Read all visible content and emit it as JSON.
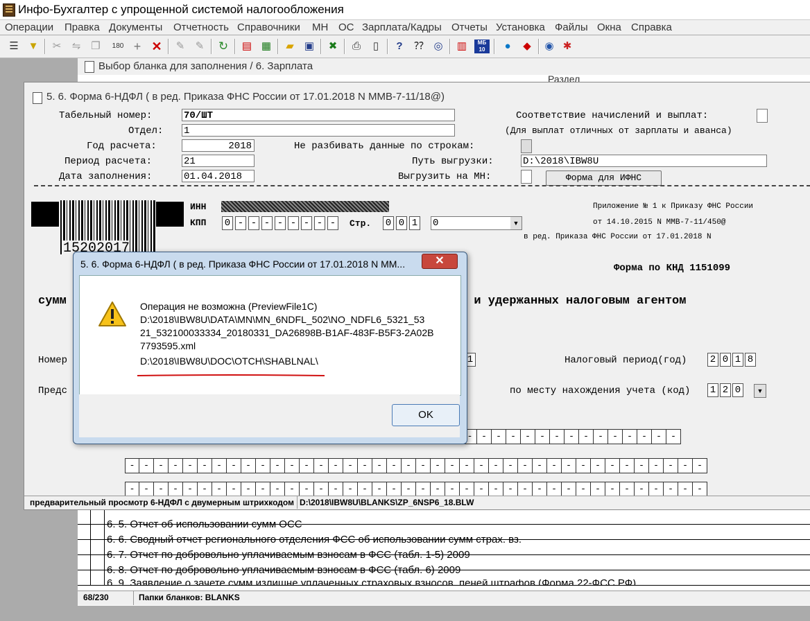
{
  "app": {
    "title": "Инфо-Бухгалтер с упрощенной системой налогообложения"
  },
  "menu": [
    "Операции",
    "Правка",
    "Документы",
    "Отчетность",
    "Справочники",
    "МН",
    "ОС",
    "Зарплата/Кадры",
    "Отчеты",
    "Установка",
    "Файлы",
    "Окна",
    "Справка"
  ],
  "toolbar": {
    "mb_icon_label": "МБ 10"
  },
  "back_window": {
    "title": "Выбор бланка для заполнения /     6. Зарплата",
    "header_partial": "Раздел",
    "rows": [
      "6. 5. Отчет об использовании сумм ОСС",
      "6. 6. Сводный отчет регионального отделения ФСС об использовании сумм страх. вз.",
      "6. 7. Отчет по добровольно уплачиваемым взносам в ФСС (табл. 1-5) 2009",
      "6. 8. Отчет по добровольно уплачиваемым взносам в ФСС (табл. 6) 2009",
      "6. 9. Заявление о зачете сумм излишне уплаченных страховых взносов, пеней штрафов (Форма 22-ФСС РФ)"
    ],
    "status_count": "68/230",
    "status_folder": "Папки бланков: BLANKS"
  },
  "form": {
    "title": "5.  6. Форма 6-НДФЛ ( в ред. Приказа ФНС России от 17.01.2018 N ММВ-7-11/18@)",
    "tabel_label": "Табельный номер:",
    "tabel_value": "70/ШТ",
    "otdel_label": "Отдел:",
    "otdel_value": "1",
    "god_label": "Год расчета:",
    "god_value": "2018",
    "period_label": "Период расчета:",
    "period_value": "21",
    "date_label": "Дата заполнения:",
    "date_value": "01.04.2018",
    "sootv_label": "Соответствие начислений и выплат:",
    "sootv_note": "(Для выплат отличных от зарплаты и аванса)",
    "nerazb_label": "Не разбивать данные по строкам:",
    "path_label": "Путь выгрузки:",
    "path_value": "D:\\2018\\IBW8U",
    "mn_label": "Выгрузить на МН:",
    "ifns_button": "Форма для ИФНС",
    "barcode_number": "15202017",
    "inn_label": "ИНН",
    "kpp_label": "КПП",
    "kpp_first": "0",
    "str_label": "Стр.",
    "str_cells": [
      "0",
      "0",
      "1"
    ],
    "str_select": "0",
    "appendix1": "Приложение № 1 к Приказу ФНС России",
    "appendix2": "от 14.10.2015 N ММВ-7-11/450@",
    "appendix3": "в ред. Приказа ФНС России от 17.01.2018 N",
    "knd": "Форма по КНД 1151099",
    "heading_left": "сумм",
    "heading_right": "х и удержанных налоговым агентом",
    "nomer_label": "Номер",
    "nomer_cell": "1",
    "nal_period_label": "Налоговый период(год)",
    "nal_period_cells": [
      "2",
      "0",
      "1",
      "8"
    ],
    "preds_label": "Предс",
    "mesto_label": "по месту нахождения учета (код)",
    "mesto_cells": [
      "1",
      "2",
      "0"
    ],
    "status_left": "предварительный просмотр 6-НДФЛ с двумерным штрихкодом",
    "status_right": "D:\\2018\\IBW8U\\BLANKS\\ZP_6NSP6_18.BLW"
  },
  "dialog": {
    "title": "5.  6. Форма 6-НДФЛ ( в ред. Приказа ФНС России от 17.01.2018 N ММ...",
    "close": "✕",
    "lines": [
      "Операция не возможна (PreviewFile1C)",
      "D:\\2018\\IBW8U\\DATA\\MN\\MN_6NDFL_502\\NO_NDFL6_5321_53",
      "21_532100033334_20180331_DA26898B-B1AF-483F-B5F3-2A02B",
      "7793595.xml",
      "D:\\2018\\IBW8U\\DOC\\OTCH\\SHABLNAL\\"
    ],
    "ok": "OK"
  }
}
